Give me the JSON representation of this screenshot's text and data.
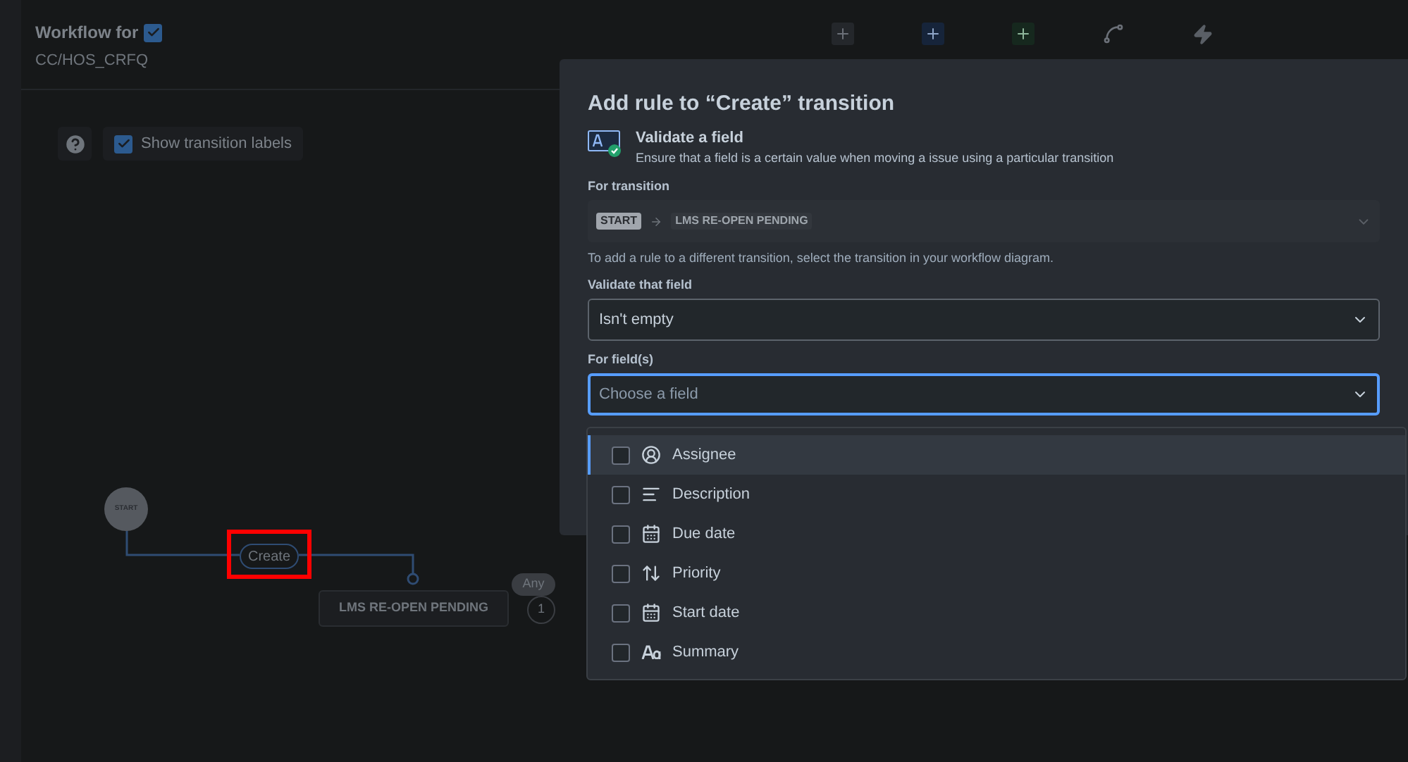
{
  "header": {
    "title": "Workflow for",
    "title_checked": true,
    "subtitle": "CC/HOS_CRFQ"
  },
  "toolbar": [
    {
      "kind": "todo"
    },
    {
      "kind": "inprogress"
    },
    {
      "kind": "done"
    },
    {
      "kind": "transition"
    },
    {
      "kind": "rule"
    }
  ],
  "label_toggle": {
    "label": "Show transition labels",
    "checked": true
  },
  "diagram": {
    "start": "START",
    "transition": "Create",
    "transition_highlighted": true,
    "status": "LMS RE-OPEN PENDING",
    "any": "Any",
    "count": "1"
  },
  "panel": {
    "title": "Add rule to “Create” transition",
    "rule_name": "Validate a field",
    "rule_description": "Ensure that a field is a certain value when moving a issue using a particular transition",
    "for_transition_label": "For transition",
    "from": "START",
    "to": "LMS RE-OPEN PENDING",
    "hint": "To add a rule to a different transition, select the transition in your workflow diagram.",
    "validate_label": "Validate that field",
    "validate_value": "Isn't empty",
    "fields_label": "For field(s)",
    "fields_placeholder": "Choose a field"
  },
  "options": [
    {
      "label": "Assignee",
      "kind": "user",
      "checked": false,
      "selected": true
    },
    {
      "label": "Description",
      "kind": "text",
      "checked": false,
      "selected": false
    },
    {
      "label": "Due date",
      "kind": "date",
      "checked": false,
      "selected": false
    },
    {
      "label": "Priority",
      "kind": "priority",
      "checked": false,
      "selected": false
    },
    {
      "label": "Start date",
      "kind": "date",
      "checked": false,
      "selected": false
    },
    {
      "label": "Summary",
      "kind": "summary",
      "checked": false,
      "selected": false
    }
  ]
}
